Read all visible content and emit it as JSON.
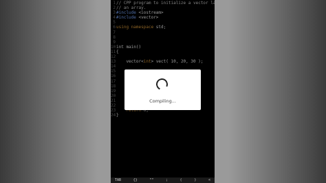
{
  "editor": {
    "lines": [
      {
        "n": "1",
        "parts": [
          {
            "t": "// CPP program to initialize a vector la",
            "c": "comment"
          }
        ]
      },
      {
        "n": "2",
        "parts": [
          {
            "t": "// an array.",
            "c": "comment"
          }
        ]
      },
      {
        "n": "3",
        "parts": [
          {
            "t": "#include ",
            "c": "pp"
          },
          {
            "t": "<iostream>",
            "c": "txt"
          }
        ]
      },
      {
        "n": "4",
        "parts": [
          {
            "t": "#include ",
            "c": "pp"
          },
          {
            "t": "<vector>",
            "c": "txt"
          }
        ]
      },
      {
        "n": "5",
        "parts": []
      },
      {
        "n": "6",
        "parts": [
          {
            "t": "using namespace ",
            "c": "kw"
          },
          {
            "t": "std;",
            "c": "txt"
          }
        ]
      },
      {
        "n": "7",
        "parts": []
      },
      {
        "n": "8",
        "parts": []
      },
      {
        "n": "9",
        "parts": []
      },
      {
        "n": "10",
        "parts": [
          {
            "t": "int main()",
            "c": "txt"
          }
        ]
      },
      {
        "n": "11",
        "parts": [
          {
            "t": "{",
            "c": "txt"
          }
        ]
      },
      {
        "n": "12",
        "parts": []
      },
      {
        "n": "13",
        "parts": [
          {
            "t": "    vector<",
            "c": "txt"
          },
          {
            "t": "int",
            "c": "kw"
          },
          {
            "t": "> vect( 10, 20, 30 );",
            "c": "txt"
          }
        ]
      },
      {
        "n": "14",
        "parts": []
      },
      {
        "n": "15",
        "parts": []
      },
      {
        "n": "16",
        "parts": []
      },
      {
        "n": "17",
        "parts": []
      },
      {
        "n": "18",
        "parts": []
      },
      {
        "n": "19",
        "parts": []
      },
      {
        "n": "20",
        "parts": []
      },
      {
        "n": "21",
        "parts": []
      },
      {
        "n": "22",
        "parts": []
      },
      {
        "n": "23",
        "parts": [
          {
            "t": "    return ",
            "c": "kw"
          },
          {
            "t": "0;",
            "c": "txt"
          }
        ]
      },
      {
        "n": "24",
        "parts": [
          {
            "t": "}",
            "c": "txt"
          }
        ]
      }
    ]
  },
  "toolbar": {
    "keys": [
      "TAB",
      "{}",
      "\"\"",
      ";",
      "(",
      ")",
      "<"
    ]
  },
  "dialog": {
    "text": "Compiling..."
  },
  "colors": {
    "comment": "#c8c8c8",
    "keyword": "#d99a3a",
    "preprocessor": "#7aa8ff",
    "text": "#e8e8e8"
  }
}
